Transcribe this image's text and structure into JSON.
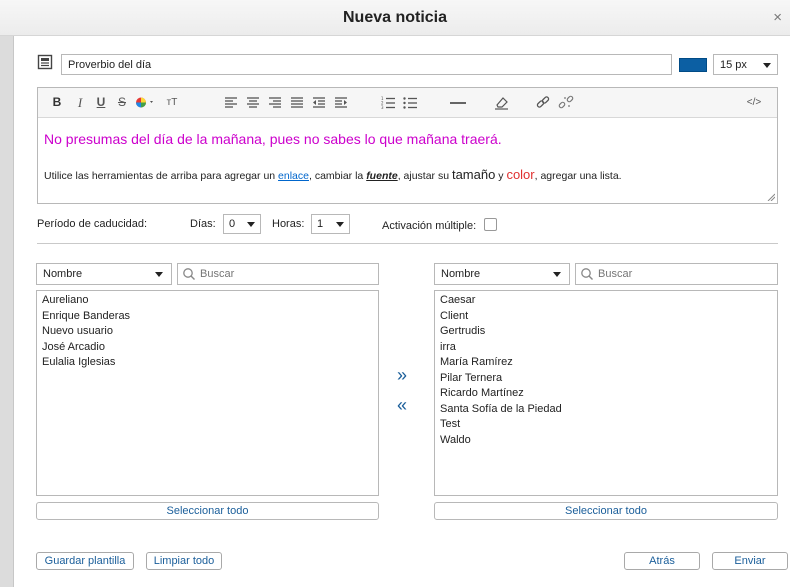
{
  "dialog": {
    "title": "Nueva noticia",
    "close": "×"
  },
  "subject": {
    "value": "Proverbio del día",
    "color": "#0c5fa3",
    "font_size": "15 px"
  },
  "toolbar": {
    "bold": "B",
    "italic": "I",
    "underline": "U",
    "strike": "S",
    "text_size": "тT",
    "source": "</>"
  },
  "editor": {
    "line1": "No presumas del día de la mañana, pues no sabes lo que mañana traerá.",
    "line2": {
      "part1": "Utilice las herramientas de arriba para agregar un ",
      "link": "enlace",
      "part2": ", cambiar la ",
      "font": "fuente",
      "part3": ", ajustar su ",
      "size": "tamaño",
      "part4": " y ",
      "color": "color",
      "part5": ", agregar una lista."
    }
  },
  "expiration": {
    "label": "Período de caducidad:",
    "days_label": "Días:",
    "days_value": "0",
    "hours_label": "Horas:",
    "hours_value": "1",
    "multi_label": "Activación múltiple:"
  },
  "left_panel": {
    "sort": "Nombre",
    "search_placeholder": "Buscar",
    "items": [
      "Aureliano",
      "Enrique Banderas",
      "Nuevo usuario",
      "José Arcadio",
      "Eulalia Iglesias"
    ],
    "select_all": "Seleccionar todo"
  },
  "right_panel": {
    "sort": "Nombre",
    "search_placeholder": "Buscar",
    "items": [
      "Caesar",
      "Client",
      "Gertrudis",
      "irra",
      "María Ramírez",
      "Pilar Ternera",
      "Ricardo Martínez",
      "Santa Sofía de la Piedad",
      "Test",
      "Waldo"
    ],
    "select_all": "Seleccionar todo"
  },
  "transfer": {
    "add": "»",
    "remove": "«"
  },
  "footer": {
    "save_template": "Guardar plantilla",
    "clear_all": "Limpiar todo",
    "back": "Atrás",
    "send": "Enviar"
  }
}
